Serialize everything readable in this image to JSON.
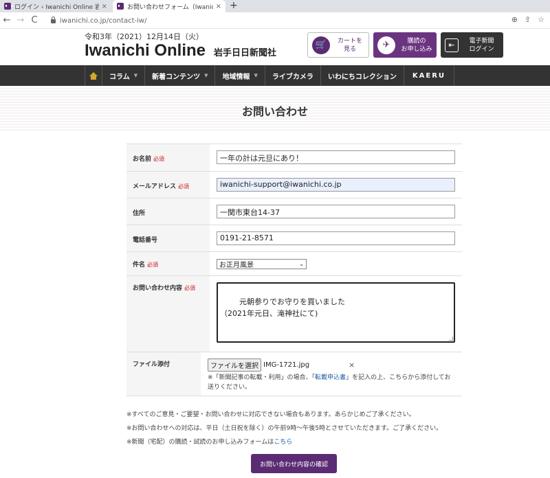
{
  "browser": {
    "tabs": [
      {
        "title": "ログイン ‹ Iwanichi Online 岩手日日",
        "close": "×"
      },
      {
        "title": "お問い合わせフォーム（Iwanichi Onl",
        "close": "×"
      }
    ],
    "new_tab": "+",
    "back": "←",
    "forward": "→",
    "reload": "C",
    "url": "iwanichi.co.jp/contact-iw/",
    "addr_icons": [
      "zoom-icon",
      "share-icon",
      "star-icon"
    ]
  },
  "header": {
    "date": "令和3年（2021）12月14日（火）",
    "logo_en": "Iwanichi Online",
    "logo_jp": "岩手日日新聞社",
    "cart_btn": {
      "line1": "カートを",
      "line2": "見る"
    },
    "subscribe_btn": {
      "line1": "購読の",
      "line2": "お申し込み"
    },
    "login_btn": {
      "line1": "電子新聞",
      "line2": "ログイン"
    }
  },
  "nav": {
    "items": [
      {
        "label": "コラム",
        "dropdown": true
      },
      {
        "label": "新着コンテンツ",
        "dropdown": true
      },
      {
        "label": "地域情報",
        "dropdown": true
      },
      {
        "label": "ライブカメラ",
        "dropdown": false
      },
      {
        "label": "いわにちコレクション",
        "dropdown": false
      },
      {
        "label": "KAERU",
        "dropdown": false
      }
    ]
  },
  "page": {
    "title": "お問い合わせ"
  },
  "form": {
    "required_mark": "必須",
    "name": {
      "label": "お名前",
      "value": "一年の計は元旦にあり！"
    },
    "email": {
      "label": "メールアドレス",
      "value": "iwanichi-support@iwanichi.co.jp"
    },
    "address": {
      "label": "住所",
      "value": "一関市東台14-37"
    },
    "phone": {
      "label": "電話番号",
      "value": "0191-21-8571"
    },
    "subject": {
      "label": "件名",
      "value": "お正月風景"
    },
    "message": {
      "label": "お問い合わせ内容",
      "value": "元朝参りでお守りを買いました\n（2021年元日、滝神社にて)"
    },
    "file": {
      "label": "ファイル添付",
      "button": "ファイルを選択",
      "filename": "IMG-1721.jpg",
      "remove": "×",
      "note_prefix": "※「新聞記事の転載・利用」の場合、「",
      "note_link": "転載申込書",
      "note_suffix": "」を記入の上、こちらから添付してお送りください。"
    }
  },
  "notes": {
    "line1": "※すべてのご意見・ご要望・お問い合わせに対応できない場合もあります。あらかじめご了承ください。",
    "line2": "※お問い合わせへの対応は、平日（土日祝を除く）の午前9時〜午後5時とさせていただきます。ご了承ください。",
    "line3_prefix": "※新聞（宅配）の購読・試読のお申し込みフォームは",
    "line3_link": "こちら"
  },
  "submit": {
    "label": "お問い合わせ内容の確認"
  },
  "colors": {
    "brand_purple": "#5b2b74",
    "nav_bg": "#333333",
    "required_red": "#c8161d",
    "link_blue": "#1f5fa8"
  }
}
